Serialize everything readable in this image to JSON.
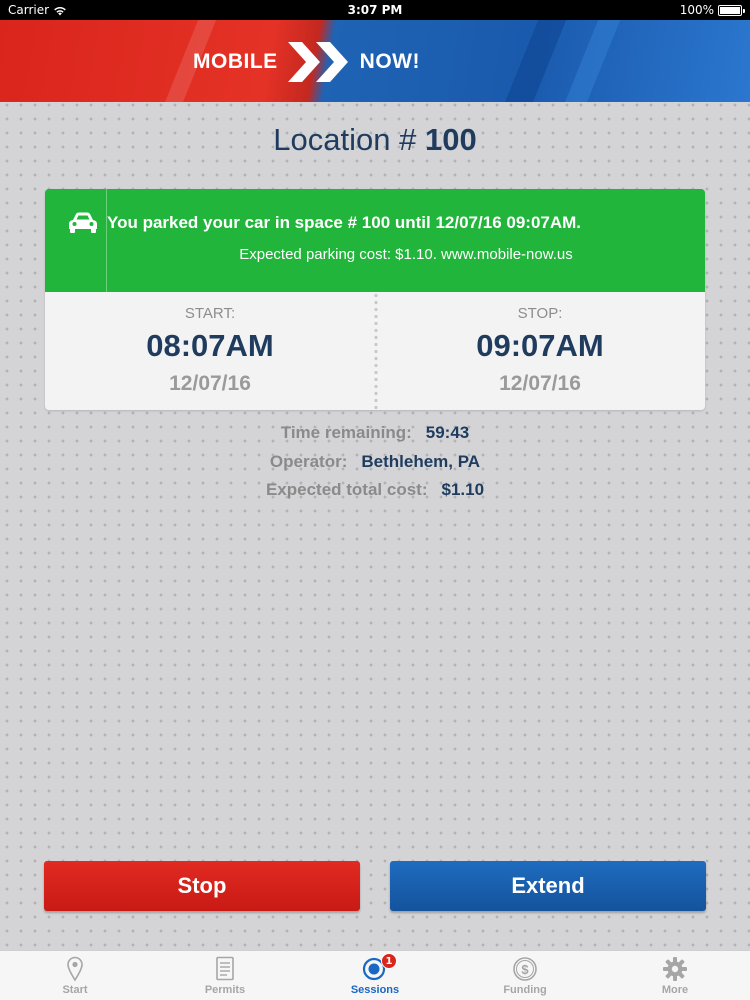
{
  "status_bar": {
    "carrier": "Carrier",
    "time": "3:07 PM",
    "battery": "100%"
  },
  "header": {
    "logo_left": "MOBILE",
    "logo_right": "NOW!"
  },
  "location": {
    "prefix": "Location #",
    "number": "100"
  },
  "session": {
    "message": "You parked your car in space # 100 until 12/07/16 09:07AM.",
    "cost_message": "Expected parking cost: $1.10. www.mobile-now.us",
    "start": {
      "label": "START:",
      "time": "08:07AM",
      "date": "12/07/16"
    },
    "stop": {
      "label": "STOP:",
      "time": "09:07AM",
      "date": "12/07/16"
    }
  },
  "details": {
    "time_remaining_label": "Time remaining:",
    "time_remaining": "59:43",
    "operator_label": "Operator:",
    "operator": "Bethlehem, PA",
    "total_cost_label": "Expected total cost:",
    "total_cost": "$1.10"
  },
  "buttons": {
    "stop": "Stop",
    "extend": "Extend"
  },
  "tabs": [
    {
      "label": "Start",
      "icon": "map-pin-icon"
    },
    {
      "label": "Permits",
      "icon": "document-icon"
    },
    {
      "label": "Sessions",
      "icon": "sessions-icon",
      "badge": "1",
      "active": true
    },
    {
      "label": "Funding",
      "icon": "dollar-coin-icon"
    },
    {
      "label": "More",
      "icon": "gear-icon"
    }
  ],
  "colors": {
    "red": "#d9251c",
    "blue": "#1a5aad",
    "green": "#21b53b",
    "navy": "#1f3c5e"
  }
}
